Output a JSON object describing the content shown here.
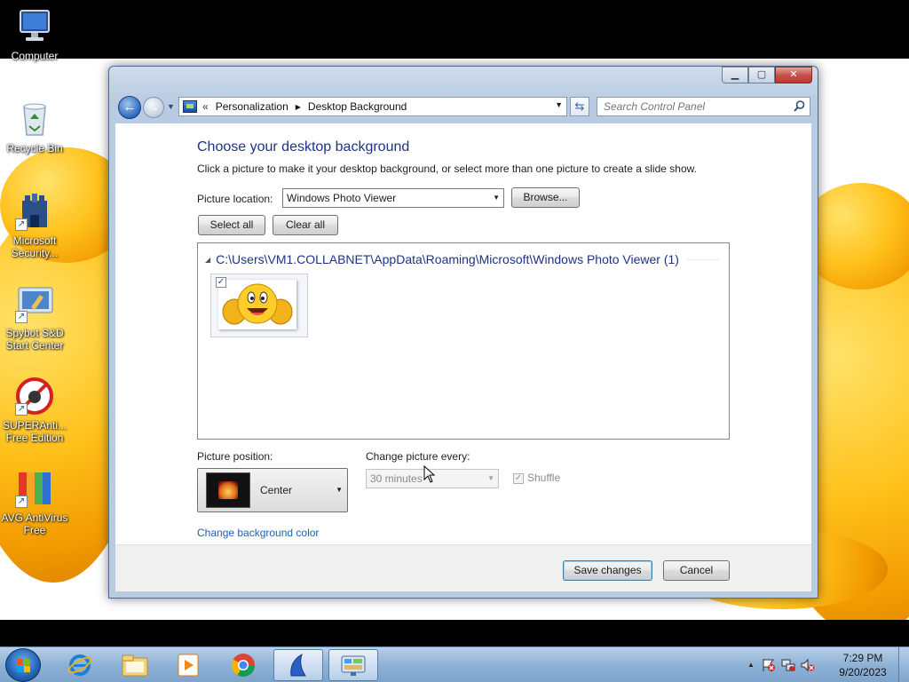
{
  "desktop": {
    "icons": [
      {
        "label": "Computer",
        "icon": "computer-icon"
      },
      {
        "label": "Recycle Bin",
        "icon": "recycle-bin-icon"
      },
      {
        "label": "Microsoft Security...",
        "icon": "security-shield-icon"
      },
      {
        "label": "Spybot S&D Start Center",
        "icon": "spybot-icon"
      },
      {
        "label": "SUPERAnti... Free Edition",
        "icon": "superantispyware-icon"
      },
      {
        "label": "AVG AntiVirus Free",
        "icon": "avg-icon"
      }
    ]
  },
  "window": {
    "address": {
      "overflow": "«",
      "crumbs": [
        "Personalization",
        "Desktop Background"
      ]
    },
    "search_placeholder": "Search Control Panel",
    "title": "Choose your desktop background",
    "subtitle": "Click a picture to make it your desktop background, or select more than one picture to create a slide show.",
    "picture_location_label": "Picture location:",
    "picture_location_value": "Windows Photo Viewer",
    "browse_label": "Browse...",
    "select_all_label": "Select all",
    "clear_all_label": "Clear all",
    "group_title": "C:\\Users\\VM1.COLLABNET\\AppData\\Roaming\\Microsoft\\Windows Photo Viewer (1)",
    "thumbnail_checked": true,
    "picture_position_label": "Picture position:",
    "picture_position_value": "Center",
    "change_every_label": "Change picture every:",
    "change_every_value": "30 minutes",
    "shuffle_label": "Shuffle",
    "change_color_link": "Change background color",
    "save_label": "Save changes",
    "cancel_label": "Cancel"
  },
  "taskbar": {
    "items": [
      "internet-explorer-icon",
      "windows-explorer-icon",
      "media-player-icon",
      "chrome-icon",
      "sailboat-app-icon",
      "control-panel-icon"
    ],
    "time": "7:29 PM",
    "date": "9/20/2023"
  }
}
